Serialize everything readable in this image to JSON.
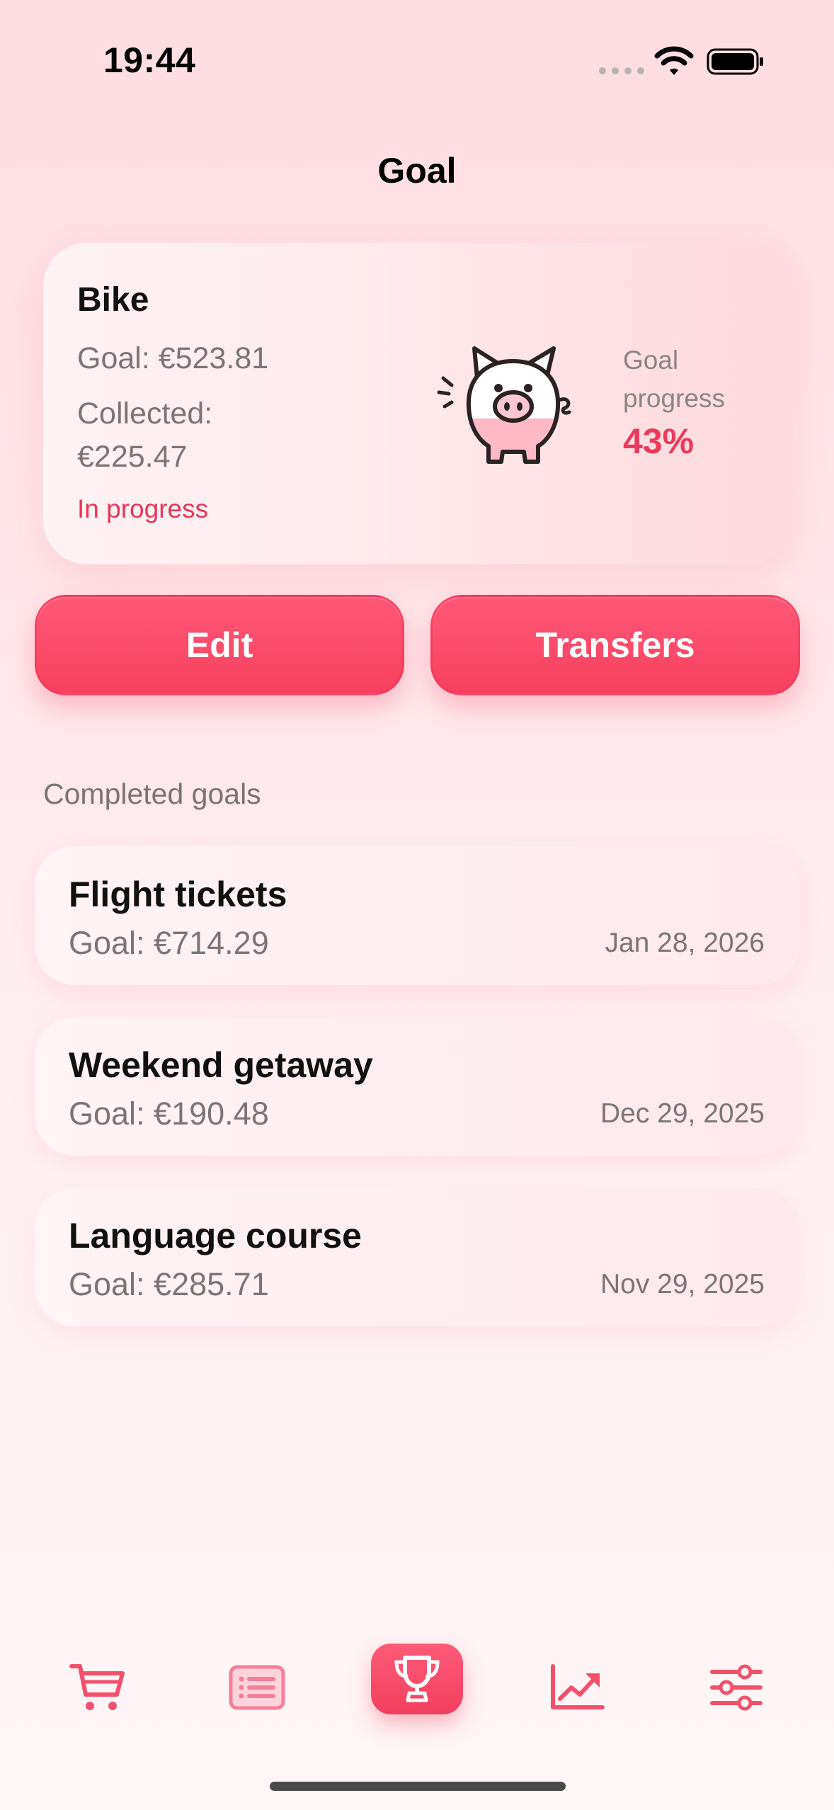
{
  "status_bar": {
    "time": "19:44"
  },
  "header": {
    "title": "Goal"
  },
  "active_goal": {
    "name": "Bike",
    "goal_text": "Goal: €523.81",
    "collected_label": "Collected:",
    "collected_value": "€225.47",
    "status": "In progress",
    "progress_label_line1": "Goal",
    "progress_label_line2": "progress",
    "progress_percent": "43%",
    "progress_fraction": 0.43
  },
  "actions": {
    "edit_label": "Edit",
    "transfers_label": "Transfers"
  },
  "completed": {
    "section_label": "Completed goals",
    "items": [
      {
        "name": "Flight tickets",
        "goal": "Goal: €714.29",
        "date": "Jan 28, 2026"
      },
      {
        "name": "Weekend getaway",
        "goal": "Goal: €190.48",
        "date": "Dec 29, 2025"
      },
      {
        "name": "Language course",
        "goal": "Goal: €285.71",
        "date": "Nov 29, 2025"
      }
    ]
  },
  "tab_bar": {
    "items": [
      {
        "icon": "cart-icon",
        "active": false
      },
      {
        "icon": "list-icon",
        "active": false
      },
      {
        "icon": "trophy-icon",
        "active": true
      },
      {
        "icon": "chart-icon",
        "active": false
      },
      {
        "icon": "sliders-icon",
        "active": false
      }
    ]
  },
  "colors": {
    "accent": "#f8405f",
    "accent_light": "#ff5777",
    "pig_fill": "#ffb8c6",
    "muted_text": "#7d7475"
  }
}
